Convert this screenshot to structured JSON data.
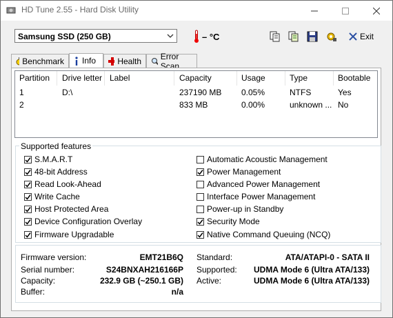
{
  "window": {
    "title": "HD Tune 2.55 - Hard Disk Utility"
  },
  "toolbar": {
    "drive": "Samsung SSD (250 GB)",
    "temperature": "– °C",
    "exit_label": "Exit"
  },
  "tabs": [
    {
      "label": "Benchmark",
      "icon": "stopwatch-icon"
    },
    {
      "label": "Info",
      "icon": "info-icon"
    },
    {
      "label": "Health",
      "icon": "health-cross-icon"
    },
    {
      "label": "Error Scan",
      "icon": "magnifier-icon"
    }
  ],
  "partitions": {
    "headers": [
      "Partition",
      "Drive letter",
      "Label",
      "Capacity",
      "Usage",
      "Type",
      "Bootable"
    ],
    "rows": [
      [
        "1",
        "D:\\",
        "",
        "237190 MB",
        "0.05%",
        "NTFS",
        "Yes"
      ],
      [
        "2",
        "",
        "",
        "833 MB",
        "0.00%",
        "unknown ...",
        "No"
      ]
    ]
  },
  "features": {
    "title": "Supported features",
    "left": [
      {
        "label": "S.M.A.R.T",
        "checked": true
      },
      {
        "label": "48-bit Address",
        "checked": true
      },
      {
        "label": "Read Look-Ahead",
        "checked": true
      },
      {
        "label": "Write Cache",
        "checked": true
      },
      {
        "label": "Host Protected Area",
        "checked": true
      },
      {
        "label": "Device Configuration Overlay",
        "checked": true
      },
      {
        "label": "Firmware Upgradable",
        "checked": true
      }
    ],
    "right": [
      {
        "label": "Automatic Acoustic Management",
        "checked": false
      },
      {
        "label": "Power Management",
        "checked": true
      },
      {
        "label": "Advanced Power Management",
        "checked": false
      },
      {
        "label": "Interface Power Management",
        "checked": false
      },
      {
        "label": "Power-up in Standby",
        "checked": false
      },
      {
        "label": "Security Mode",
        "checked": true
      },
      {
        "label": "Native Command Queuing (NCQ)",
        "checked": true
      }
    ]
  },
  "info": {
    "firmware_label": "Firmware version:",
    "firmware": "EMT21B6Q",
    "serial_label": "Serial number:",
    "serial": "S24BNXAH216166P",
    "capacity_label": "Capacity:",
    "capacity": "232.9 GB (~250.1 GB)",
    "buffer_label": "Buffer:",
    "buffer": "n/a",
    "standard_label": "Standard:",
    "standard": "ATA/ATAPI-0 - SATA II",
    "supported_label": "Supported:",
    "supported": "UDMA Mode 6 (Ultra ATA/133)",
    "active_label": "Active:",
    "active": "UDMA Mode 6 (Ultra ATA/133)"
  }
}
